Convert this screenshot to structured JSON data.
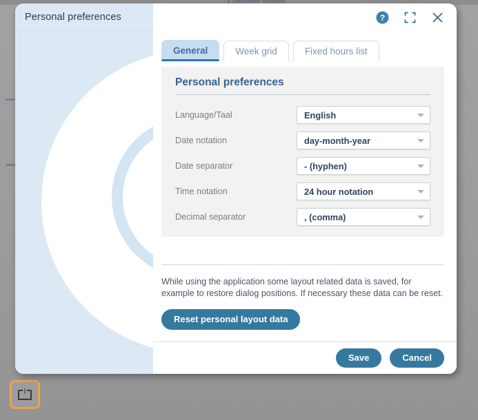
{
  "background": {
    "partial_text_top": "Customer mainm",
    "taskbar_icon": "restore-window-icon"
  },
  "dialog": {
    "title": "Personal preferences",
    "titlebar_icons": [
      {
        "name": "help-icon",
        "glyph": "?"
      },
      {
        "name": "maximize-icon",
        "glyph": "⛶"
      },
      {
        "name": "close-icon",
        "glyph": "×"
      }
    ],
    "watermark_icon": "refresh-circle-arrow-icon"
  },
  "tabs": [
    {
      "label": "General",
      "active": true
    },
    {
      "label": "Week grid",
      "active": false
    },
    {
      "label": "Fixed hours list",
      "active": false
    }
  ],
  "form": {
    "heading": "Personal preferences",
    "fields": [
      {
        "label": "Language/Taal",
        "value": "English"
      },
      {
        "label": "Date notation",
        "value": "day-month-year"
      },
      {
        "label": "Date separator",
        "value": "- (hyphen)"
      },
      {
        "label": "Time notation",
        "value": "24 hour notation"
      },
      {
        "label": "Decimal separator",
        "value": ", (comma)"
      }
    ]
  },
  "reset_section": {
    "description": "While using the application some layout related data is saved, for example to restore dialog positions. If necessary these data can be reset.",
    "button_label": "Reset personal layout data"
  },
  "footer": {
    "save_label": "Save",
    "cancel_label": "Cancel"
  },
  "colors": {
    "accent_blue": "#35799f",
    "tab_active_bg": "#c6dcf0",
    "tab_underline": "#2d77b5",
    "sidebar_bg": "#dce9f5",
    "heading_blue": "#35638f",
    "highlight_orange": "#f0a04b",
    "panel_grey": "#f2f2f2"
  }
}
